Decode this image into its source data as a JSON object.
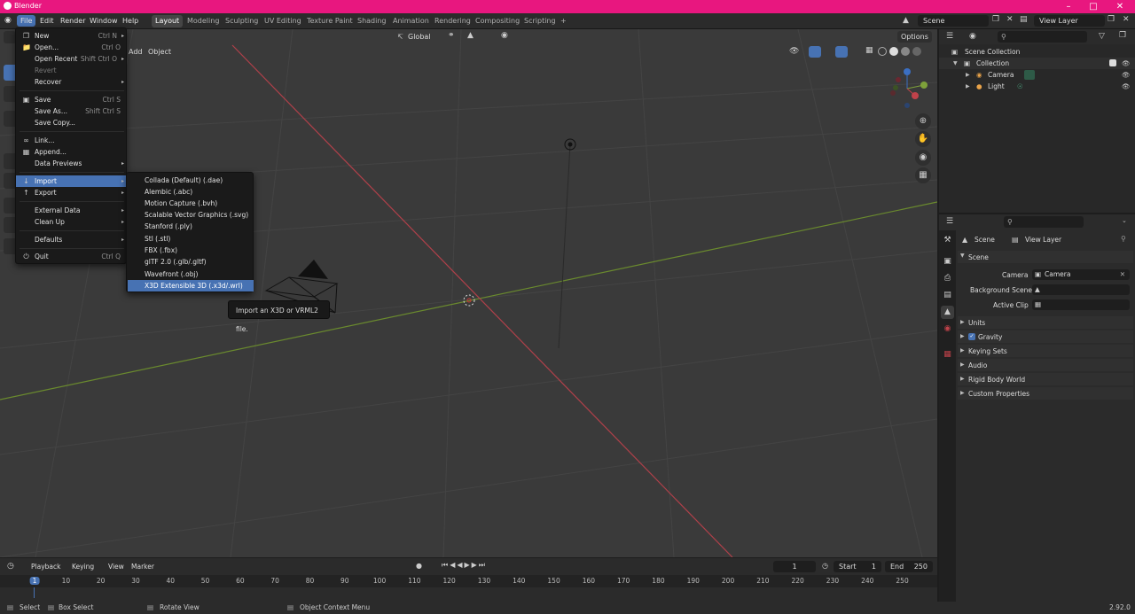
{
  "window": {
    "title": "Blender"
  },
  "topbar": {
    "menus": [
      "File",
      "Edit",
      "Render",
      "Window",
      "Help"
    ],
    "workspaces": [
      "Layout",
      "Modeling",
      "Sculpting",
      "UV Editing",
      "Texture Paint",
      "Shading",
      "Animation",
      "Rendering",
      "Compositing",
      "Scripting"
    ],
    "active_workspace": "Layout",
    "add_tab": "+",
    "scene": "Scene",
    "view_layer": "View Layer"
  },
  "viewport": {
    "header_menus": [
      "Add",
      "Object"
    ],
    "transform_orientation": "Global",
    "options": "Options"
  },
  "file_menu": {
    "items": [
      {
        "label": "New",
        "shortcut": "Ctrl N",
        "icon": "new-file-icon",
        "arrow": true
      },
      {
        "label": "Open...",
        "shortcut": "Ctrl O",
        "icon": "folder-icon"
      },
      {
        "label": "Open Recent",
        "shortcut": "Shift Ctrl O",
        "arrow": true
      },
      {
        "label": "Revert",
        "dim": true
      },
      {
        "label": "Recover",
        "arrow": true
      },
      {
        "label": "Save",
        "shortcut": "Ctrl S",
        "icon": "save-icon"
      },
      {
        "label": "Save As...",
        "shortcut": "Shift Ctrl S"
      },
      {
        "label": "Save Copy..."
      },
      {
        "label": "Link...",
        "icon": "link-icon"
      },
      {
        "label": "Append...",
        "icon": "append-icon"
      },
      {
        "label": "Data Previews",
        "arrow": true
      },
      {
        "label": "Import",
        "icon": "import-icon",
        "arrow": true,
        "highlight": true
      },
      {
        "label": "Export",
        "icon": "export-icon",
        "arrow": true
      },
      {
        "label": "External Data",
        "arrow": true
      },
      {
        "label": "Clean Up",
        "arrow": true
      },
      {
        "label": "Defaults",
        "arrow": true
      },
      {
        "label": "Quit",
        "shortcut": "Ctrl Q",
        "icon": "quit-icon"
      }
    ]
  },
  "import_menu": {
    "items": [
      "Collada (Default) (.dae)",
      "Alembic (.abc)",
      "Motion Capture (.bvh)",
      "Scalable Vector Graphics (.svg)",
      "Stanford (.ply)",
      "Stl (.stl)",
      "FBX (.fbx)",
      "glTF 2.0 (.glb/.gltf)",
      "Wavefront (.obj)",
      "X3D Extensible 3D (.x3d/.wrl)"
    ],
    "highlighted": "X3D Extensible 3D (.x3d/.wrl)"
  },
  "tooltip": "Import an X3D or VRML2 file.",
  "outliner": {
    "scene_collection": "Scene Collection",
    "collection": "Collection",
    "items": [
      "Camera",
      "Light"
    ]
  },
  "properties": {
    "breadcrumb_scene": "Scene",
    "breadcrumb_view_layer": "View Layer",
    "section": "Scene",
    "camera_label": "Camera",
    "camera_value": "Camera",
    "background_scene_label": "Background Scene",
    "active_clip_label": "Active Clip",
    "panels": [
      "Units",
      "Gravity",
      "Keying Sets",
      "Audio",
      "Rigid Body World",
      "Custom Properties"
    ],
    "gravity_checked": true
  },
  "timeline": {
    "menus": [
      "Playback",
      "Keying",
      "View",
      "Marker"
    ],
    "current_frame": "1",
    "start_label": "Start",
    "start": "1",
    "end_label": "End",
    "end": "250",
    "ruler": [
      "1",
      "10",
      "20",
      "30",
      "40",
      "50",
      "60",
      "70",
      "80",
      "90",
      "100",
      "110",
      "120",
      "130",
      "140",
      "150",
      "160",
      "170",
      "180",
      "190",
      "200",
      "210",
      "220",
      "230",
      "240",
      "250"
    ]
  },
  "statusbar": {
    "select": "Select",
    "box_select": "Box Select",
    "rotate_view": "Rotate View",
    "context_menu": "Object Context Menu",
    "version": "2.92.0"
  },
  "colors": {
    "accent": "#4772b3",
    "titlebar": "#e8177f",
    "x_axis": "#c0424a",
    "y_axis": "#7ea13a"
  }
}
